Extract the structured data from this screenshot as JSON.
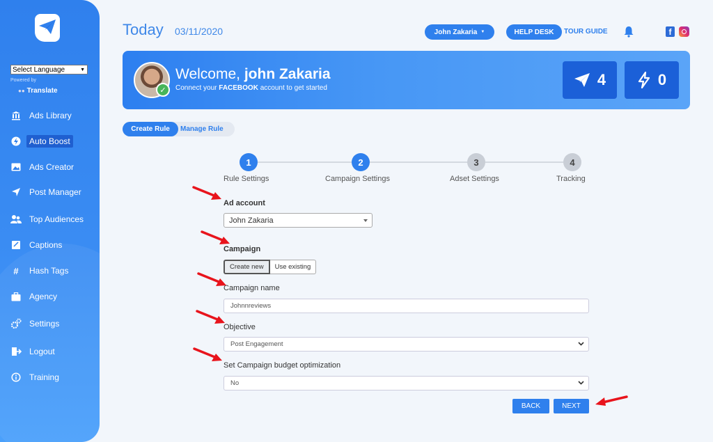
{
  "sidebar": {
    "language_select": "Select Language",
    "powered_by": "Powered by",
    "translate": "Translate",
    "items": [
      {
        "label": "Ads Library",
        "icon": "bank-icon"
      },
      {
        "label": "Auto Boost",
        "icon": "bolt-icon"
      },
      {
        "label": "Ads Creator",
        "icon": "image-icon"
      },
      {
        "label": "Post Manager",
        "icon": "send-icon"
      },
      {
        "label": "Top Audiences",
        "icon": "users-icon"
      },
      {
        "label": "Captions",
        "icon": "caption-icon"
      },
      {
        "label": "Hash Tags",
        "icon": "hash-icon"
      },
      {
        "label": "Agency",
        "icon": "briefcase-icon"
      },
      {
        "label": "Settings",
        "icon": "gears-icon"
      },
      {
        "label": "Logout",
        "icon": "logout-icon"
      },
      {
        "label": "Training",
        "icon": "info-icon"
      }
    ]
  },
  "header": {
    "today": "Today",
    "date": "03/11/2020",
    "user": "John Zakaria",
    "help_desk": "HELP DESK",
    "tour_guide": "TOUR GUIDE",
    "facebook_letter": "f"
  },
  "banner": {
    "welcome_prefix": "Welcome,",
    "name": "john Zakaria",
    "connect_prefix": "Connect your",
    "connect_brand": "FACEBOOK",
    "connect_suffix": "account to get started",
    "stat_posts": "4",
    "stat_boosts": "0"
  },
  "tabs": {
    "create": "Create Rule",
    "manage": "Manage Rule"
  },
  "steps": [
    {
      "num": "1",
      "label": "Rule Settings",
      "state": "done"
    },
    {
      "num": "2",
      "label": "Campaign Settings",
      "state": "done"
    },
    {
      "num": "3",
      "label": "Adset Settings",
      "state": "todo"
    },
    {
      "num": "4",
      "label": "Tracking",
      "state": "todo"
    }
  ],
  "form": {
    "ad_account_label": "Ad account",
    "ad_account_value": "John Zakaria",
    "campaign_label": "Campaign",
    "create_new": "Create new",
    "use_existing": "Use existing",
    "campaign_name_label": "Campaign name",
    "campaign_name_value": "Johnnreviews",
    "objective_label": "Objective",
    "objective_value": "Post Engagement",
    "cbo_label": "Set Campaign budget optimization",
    "cbo_value": "No",
    "back": "BACK",
    "next": "NEXT"
  },
  "colors": {
    "primary": "#2f80ed",
    "dark_blue": "#1b60d8",
    "annotation_red": "#e8141c"
  }
}
